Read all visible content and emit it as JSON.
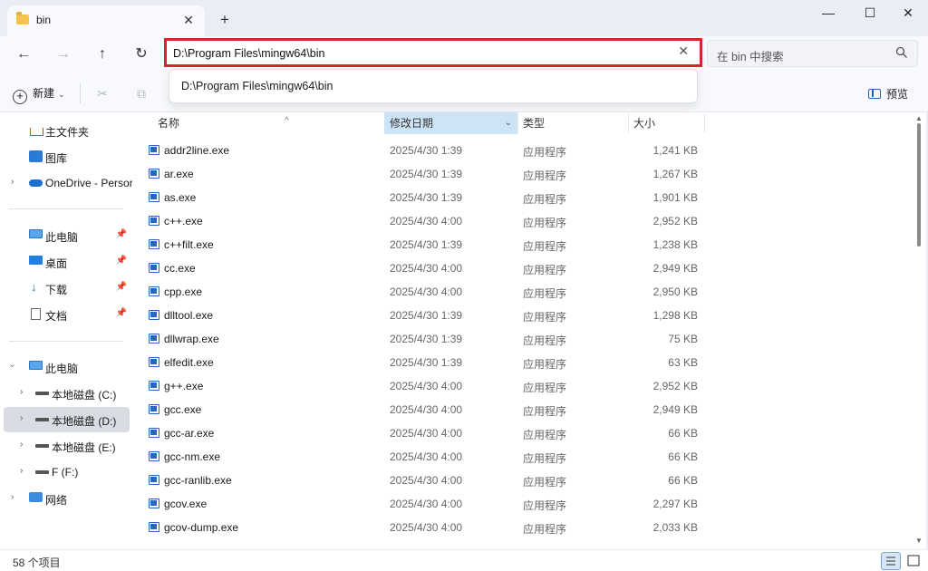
{
  "window": {
    "tab_title": "bin",
    "tab_close": "✕",
    "new_tab": "+",
    "minimize": "—",
    "maximize": "☐",
    "close": "✕"
  },
  "nav": {
    "back": "←",
    "forward": "→",
    "up": "↑",
    "refresh": "↻"
  },
  "address": {
    "value": "D:\\Program Files\\mingw64\\bin",
    "clear": "✕",
    "suggestion": "D:\\Program Files\\mingw64\\bin"
  },
  "search": {
    "placeholder": "在 bin 中搜索"
  },
  "toolbar": {
    "new_label": "新建",
    "preview_label": "预览"
  },
  "sidebar": {
    "quick": [
      {
        "label": "主文件夹",
        "icon": "home-icon"
      },
      {
        "label": "图库",
        "icon": "gallery-icon"
      },
      {
        "label": "OneDrive - Persor",
        "icon": "onedrive-icon"
      }
    ],
    "pinned": [
      {
        "label": "此电脑",
        "icon": "pc-icon"
      },
      {
        "label": "桌面",
        "icon": "desktop-icon"
      },
      {
        "label": "下载",
        "icon": "download-icon"
      },
      {
        "label": "文档",
        "icon": "document-icon"
      }
    ],
    "tree": [
      {
        "label": "此电脑",
        "icon": "pc-icon"
      },
      {
        "label": "本地磁盘 (C:)",
        "icon": "drive-icon"
      },
      {
        "label": "本地磁盘 (D:)",
        "icon": "drive-icon"
      },
      {
        "label": "本地磁盘 (E:)",
        "icon": "drive-icon"
      },
      {
        "label": "F (F:)",
        "icon": "drive-icon"
      },
      {
        "label": "网络",
        "icon": "network-icon"
      }
    ]
  },
  "columns": {
    "name": "名称",
    "date": "修改日期",
    "type": "类型",
    "size": "大小"
  },
  "files": [
    {
      "name": "addr2line.exe",
      "date": "2025/4/30 1:39",
      "type": "应用程序",
      "size": "1,241 KB"
    },
    {
      "name": "ar.exe",
      "date": "2025/4/30 1:39",
      "type": "应用程序",
      "size": "1,267 KB"
    },
    {
      "name": "as.exe",
      "date": "2025/4/30 1:39",
      "type": "应用程序",
      "size": "1,901 KB"
    },
    {
      "name": "c++.exe",
      "date": "2025/4/30 4:00",
      "type": "应用程序",
      "size": "2,952 KB"
    },
    {
      "name": "c++filt.exe",
      "date": "2025/4/30 1:39",
      "type": "应用程序",
      "size": "1,238 KB"
    },
    {
      "name": "cc.exe",
      "date": "2025/4/30 4:00",
      "type": "应用程序",
      "size": "2,949 KB"
    },
    {
      "name": "cpp.exe",
      "date": "2025/4/30 4:00",
      "type": "应用程序",
      "size": "2,950 KB"
    },
    {
      "name": "dlltool.exe",
      "date": "2025/4/30 1:39",
      "type": "应用程序",
      "size": "1,298 KB"
    },
    {
      "name": "dllwrap.exe",
      "date": "2025/4/30 1:39",
      "type": "应用程序",
      "size": "75 KB"
    },
    {
      "name": "elfedit.exe",
      "date": "2025/4/30 1:39",
      "type": "应用程序",
      "size": "63 KB"
    },
    {
      "name": "g++.exe",
      "date": "2025/4/30 4:00",
      "type": "应用程序",
      "size": "2,952 KB"
    },
    {
      "name": "gcc.exe",
      "date": "2025/4/30 4:00",
      "type": "应用程序",
      "size": "2,949 KB"
    },
    {
      "name": "gcc-ar.exe",
      "date": "2025/4/30 4:00",
      "type": "应用程序",
      "size": "66 KB"
    },
    {
      "name": "gcc-nm.exe",
      "date": "2025/4/30 4:00",
      "type": "应用程序",
      "size": "66 KB"
    },
    {
      "name": "gcc-ranlib.exe",
      "date": "2025/4/30 4:00",
      "type": "应用程序",
      "size": "66 KB"
    },
    {
      "name": "gcov.exe",
      "date": "2025/4/30 4:00",
      "type": "应用程序",
      "size": "2,297 KB"
    },
    {
      "name": "gcov-dump.exe",
      "date": "2025/4/30 4:00",
      "type": "应用程序",
      "size": "2,033 KB"
    }
  ],
  "status": {
    "item_count": "58 个项目"
  },
  "colors": {
    "address_highlight": "#d7262e",
    "sorted_column": "#cde3f6",
    "selected_nav": "#d9dde3"
  }
}
